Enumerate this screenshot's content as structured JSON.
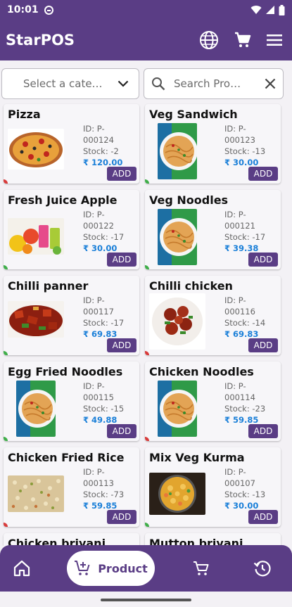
{
  "status": {
    "time": "10:01"
  },
  "appbar": {
    "title": "StarPOS"
  },
  "filters": {
    "category_placeholder": "Select a cate…",
    "search_placeholder": "Search Pro…"
  },
  "products": [
    {
      "name": "Pizza",
      "id": "ID: P-000124",
      "stock": "Stock: -2",
      "price": "₹ 120.00",
      "add_label": "ADD",
      "image": "pizza",
      "dot_color": "#d83a3a"
    },
    {
      "name": "Veg Sandwich",
      "id": "ID: P-000123",
      "stock": "Stock: -13",
      "price": "₹ 30.00",
      "add_label": "ADD",
      "image": "noodles",
      "dot_color": "#3fae49"
    },
    {
      "name": "Fresh Juice Apple",
      "id": "ID: P-000122",
      "stock": "Stock: -17",
      "price": "₹ 30.00",
      "add_label": "ADD",
      "image": "juice",
      "dot_color": "#3fae49"
    },
    {
      "name": "Veg Noodles",
      "id": "ID: P-000121",
      "stock": "Stock: -17",
      "price": "₹ 39.38",
      "add_label": "ADD",
      "image": "noodles",
      "dot_color": "#3fae49"
    },
    {
      "name": "Chilli panner",
      "id": "ID: P-000117",
      "stock": "Stock: -17",
      "price": "₹ 69.83",
      "add_label": "ADD",
      "image": "paneer",
      "dot_color": "#3fae49"
    },
    {
      "name": "Chilli chicken",
      "id": "ID: P-000116",
      "stock": "Stock: -14",
      "price": "₹ 69.83",
      "add_label": "ADD",
      "image": "chicken",
      "dot_color": "#d83a3a"
    },
    {
      "name": "Egg Fried Noodles",
      "id": "ID: P-000115",
      "stock": "Stock: -15",
      "price": "₹ 49.88",
      "add_label": "ADD",
      "image": "noodles",
      "dot_color": "#3fae49"
    },
    {
      "name": "Chicken Noodles",
      "id": "ID: P-000114",
      "stock": "Stock: -23",
      "price": "₹ 59.85",
      "add_label": "ADD",
      "image": "noodles",
      "dot_color": "#d83a3a"
    },
    {
      "name": "Chicken Fried Rice",
      "id": "ID: P-000113",
      "stock": "Stock: -73",
      "price": "₹ 59.85",
      "add_label": "ADD",
      "image": "rice",
      "dot_color": "#d83a3a"
    },
    {
      "name": "Mix Veg Kurma",
      "id": "ID: P-000107",
      "stock": "Stock: -13",
      "price": "₹ 30.00",
      "add_label": "ADD",
      "image": "kurma",
      "dot_color": "#3fae49"
    },
    {
      "name": "Chicken briyani",
      "id": "",
      "stock": "",
      "price": "",
      "add_label": "",
      "image": "",
      "dot_color": ""
    },
    {
      "name": "Mutton briyani",
      "id": "",
      "stock": "",
      "price": "",
      "add_label": "",
      "image": "",
      "dot_color": ""
    }
  ],
  "bottomnav": {
    "active_label": "Product",
    "items": [
      "home-icon",
      "product-icon",
      "cart-icon",
      "history-icon"
    ]
  },
  "colors": {
    "primary": "#5a3d85",
    "price": "#1a7fd8",
    "veg": "#3fae49",
    "nonveg": "#d83a3a"
  }
}
